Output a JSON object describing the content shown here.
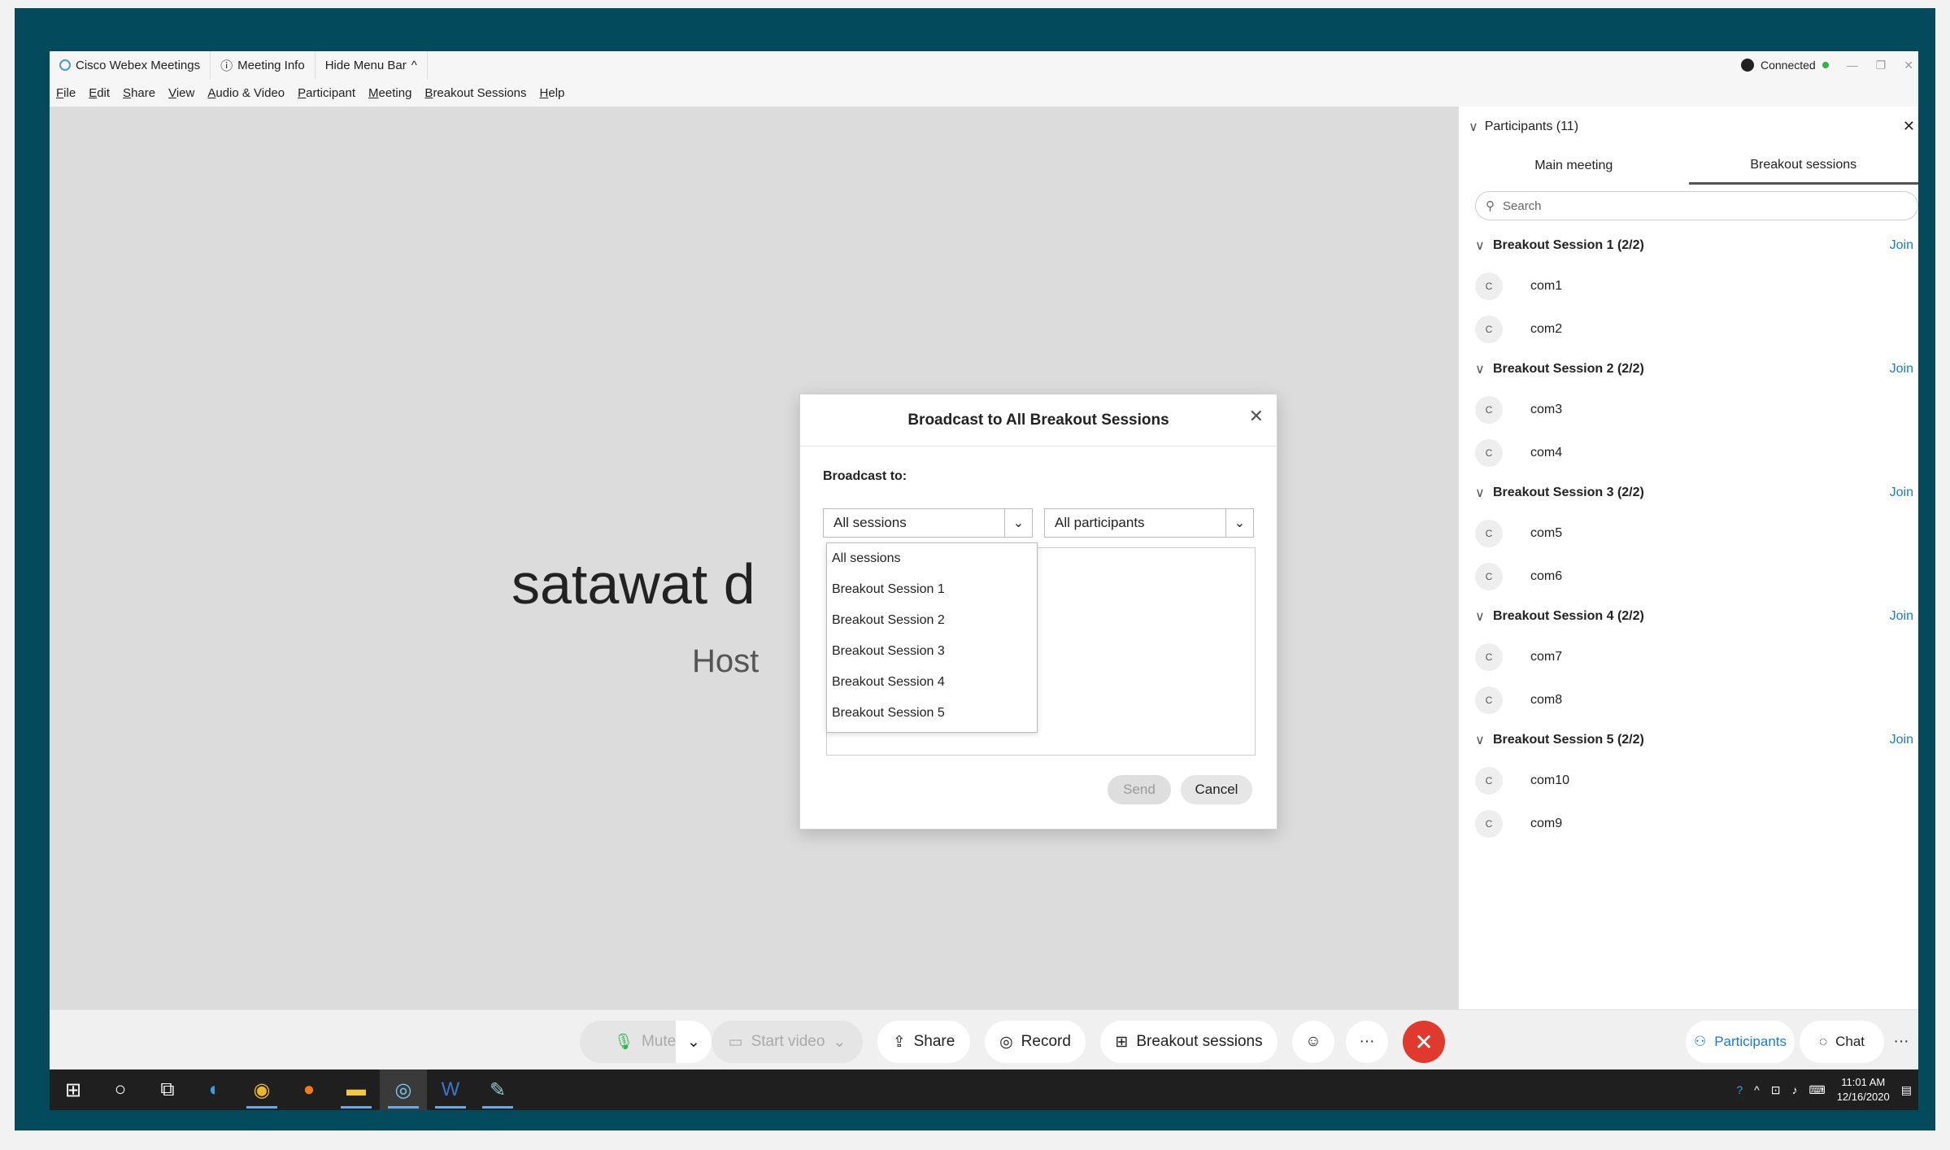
{
  "titlebar": {
    "app": "Cisco Webex Meetings",
    "meeting_info": "Meeting Info",
    "hide_menu": "Hide Menu Bar",
    "status": "Connected"
  },
  "menu": [
    "File",
    "Edit",
    "Share",
    "View",
    "Audio & Video",
    "Participant",
    "Meeting",
    "Breakout Sessions",
    "Help"
  ],
  "stage": {
    "name": "satawat d",
    "role": "Host"
  },
  "panel": {
    "title": "Participants (11)",
    "tabs": [
      "Main meeting",
      "Breakout sessions"
    ],
    "search_placeholder": "Search",
    "join_label": "Join",
    "sessions": [
      {
        "name": "Breakout Session 1 (2/2)",
        "members": [
          {
            "initial": "C",
            "name": "com1"
          },
          {
            "initial": "C",
            "name": "com2"
          }
        ]
      },
      {
        "name": "Breakout Session 2 (2/2)",
        "members": [
          {
            "initial": "C",
            "name": "com3"
          },
          {
            "initial": "C",
            "name": "com4"
          }
        ]
      },
      {
        "name": "Breakout Session 3 (2/2)",
        "members": [
          {
            "initial": "C",
            "name": "com5"
          },
          {
            "initial": "C",
            "name": "com6"
          }
        ]
      },
      {
        "name": "Breakout Session 4 (2/2)",
        "members": [
          {
            "initial": "C",
            "name": "com7"
          },
          {
            "initial": "C",
            "name": "com8"
          }
        ]
      },
      {
        "name": "Breakout Session 5 (2/2)",
        "members": [
          {
            "initial": "C",
            "name": "com10"
          },
          {
            "initial": "C",
            "name": "com9"
          }
        ]
      }
    ]
  },
  "toolbar": {
    "mute": "Mute",
    "start_video": "Start video",
    "share": "Share",
    "record": "Record",
    "breakout": "Breakout sessions",
    "participants": "Participants",
    "chat": "Chat",
    "more": "···"
  },
  "dialog": {
    "title": "Broadcast to All Breakout Sessions",
    "broadcast_to": "Broadcast to:",
    "session_select": "All sessions",
    "participant_select": "All participants",
    "options": [
      "All sessions",
      "Breakout Session 1",
      "Breakout Session 2",
      "Breakout Session 3",
      "Breakout Session 4",
      "Breakout Session 5"
    ],
    "send": "Send",
    "cancel": "Cancel"
  },
  "taskbar": {
    "time": "11:01 AM",
    "date": "12/16/2020"
  },
  "colors": {
    "accent": "#1b7ad7",
    "end_call": "#e03a2e",
    "frame": "#034b5c"
  }
}
